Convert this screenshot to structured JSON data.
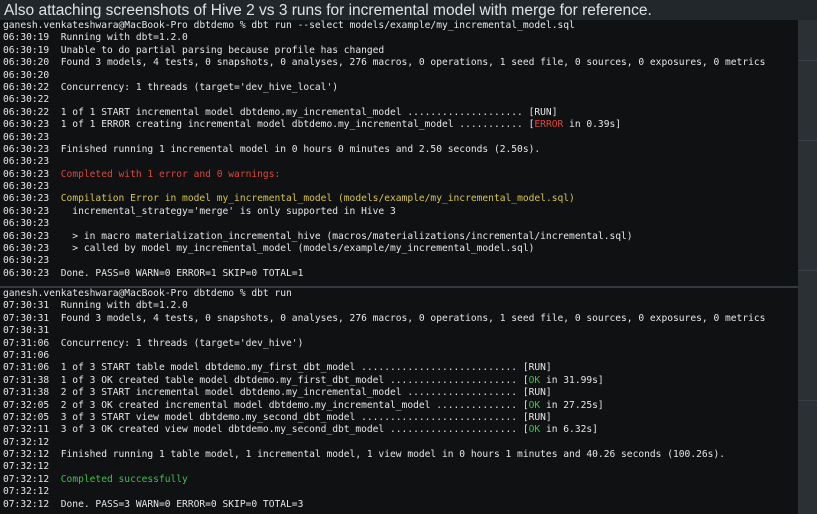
{
  "caption": "Also attaching screenshots of Hive 2 vs 3 runs for incremental model with merge for reference.",
  "terminal1": {
    "lines": [
      [
        {
          "t": "ganesh.venkateshwara@MacBook-Pro dbtdemo % dbt run --select models/example/my_incremental_model.sql"
        }
      ],
      [
        {
          "t": "06:30:19  Running with dbt=1.2.0"
        }
      ],
      [
        {
          "t": "06:30:19  Unable to do partial parsing because profile has changed"
        }
      ],
      [
        {
          "t": "06:30:20  Found 3 models, 4 tests, 0 snapshots, 0 analyses, 276 macros, 0 operations, 1 seed file, 0 sources, 0 exposures, 0 metrics"
        }
      ],
      [
        {
          "t": "06:30:20"
        }
      ],
      [
        {
          "t": "06:30:22  Concurrency: 1 threads (target='dev_hive_local')"
        }
      ],
      [
        {
          "t": "06:30:22"
        }
      ],
      [
        {
          "t": "06:30:22  1 of 1 START incremental model dbtdemo.my_incremental_model .................... [RUN]"
        }
      ],
      [
        {
          "t": "06:30:23  1 of 1 ERROR creating incremental model dbtdemo.my_incremental_model ........... ["
        },
        {
          "t": "ERROR",
          "c": "red"
        },
        {
          "t": " in 0.39s]"
        }
      ],
      [
        {
          "t": "06:30:23"
        }
      ],
      [
        {
          "t": "06:30:23  Finished running 1 incremental model in 0 hours 0 minutes and 2.50 seconds (2.50s)."
        }
      ],
      [
        {
          "t": "06:30:23"
        }
      ],
      [
        {
          "t": "06:30:23  "
        },
        {
          "t": "Completed with 1 error and 0 warnings:",
          "c": "red"
        }
      ],
      [
        {
          "t": "06:30:23"
        }
      ],
      [
        {
          "t": "06:30:23  "
        },
        {
          "t": "Compilation Error in model my_incremental_model (models/example/my_incremental_model.sql)",
          "c": "yellow"
        }
      ],
      [
        {
          "t": "06:30:23    incremental_strategy='merge' is only supported in Hive 3"
        }
      ],
      [
        {
          "t": "06:30:23"
        }
      ],
      [
        {
          "t": "06:30:23    > in macro materialization_incremental_hive (macros/materializations/incremental/incremental.sql)"
        }
      ],
      [
        {
          "t": "06:30:23    > called by model my_incremental_model (models/example/my_incremental_model.sql)"
        }
      ],
      [
        {
          "t": "06:30:23"
        }
      ],
      [
        {
          "t": "06:30:23  Done. PASS=0 WARN=0 ERROR=1 SKIP=0 TOTAL=1"
        }
      ]
    ]
  },
  "terminal2": {
    "lines": [
      [
        {
          "t": "ganesh.venkateshwara@MacBook-Pro dbtdemo % dbt run"
        }
      ],
      [
        {
          "t": "07:30:31  Running with dbt=1.2.0"
        }
      ],
      [
        {
          "t": "07:30:31  Found 3 models, 4 tests, 0 snapshots, 0 analyses, 276 macros, 0 operations, 1 seed file, 0 sources, 0 exposures, 0 metrics"
        }
      ],
      [
        {
          "t": "07:30:31"
        }
      ],
      [
        {
          "t": "07:31:06  Concurrency: 1 threads (target='dev_hive')"
        }
      ],
      [
        {
          "t": "07:31:06"
        }
      ],
      [
        {
          "t": "07:31:06  1 of 3 START table model dbtdemo.my_first_dbt_model ........................... [RUN]"
        }
      ],
      [
        {
          "t": "07:31:38  1 of 3 OK created table model dbtdemo.my_first_dbt_model ...................... ["
        },
        {
          "t": "OK",
          "c": "green"
        },
        {
          "t": " in 31.99s]"
        }
      ],
      [
        {
          "t": "07:31:38  2 of 3 START incremental model dbtdemo.my_incremental_model ................... [RUN]"
        }
      ],
      [
        {
          "t": "07:32:05  2 of 3 OK created incremental model dbtdemo.my_incremental_model .............. ["
        },
        {
          "t": "OK",
          "c": "green"
        },
        {
          "t": " in 27.25s]"
        }
      ],
      [
        {
          "t": "07:32:05  3 of 3 START view model dbtdemo.my_second_dbt_model ........................... [RUN]"
        }
      ],
      [
        {
          "t": "07:32:11  3 of 3 OK created view model dbtdemo.my_second_dbt_model ...................... ["
        },
        {
          "t": "OK",
          "c": "green"
        },
        {
          "t": " in 6.32s]"
        }
      ],
      [
        {
          "t": "07:32:12"
        }
      ],
      [
        {
          "t": "07:32:12  Finished running 1 table model, 1 incremental model, 1 view model in 0 hours 1 minutes and 40.26 seconds (100.26s)."
        }
      ],
      [
        {
          "t": "07:32:12"
        }
      ],
      [
        {
          "t": "07:32:12  "
        },
        {
          "t": "Completed successfully",
          "c": "green"
        }
      ],
      [
        {
          "t": "07:32:12"
        }
      ],
      [
        {
          "t": "07:32:12  Done. PASS=3 WARN=0 ERROR=0 SKIP=0 TOTAL=3"
        }
      ]
    ]
  }
}
